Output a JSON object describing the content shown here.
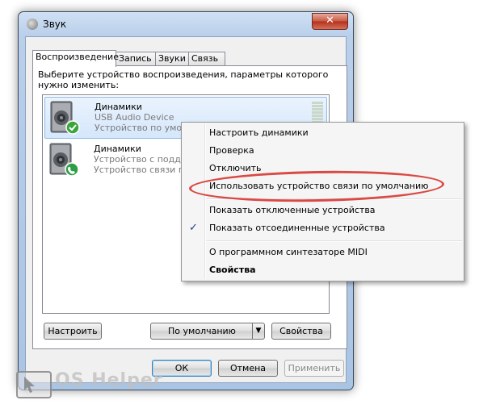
{
  "window": {
    "title": "Звук",
    "close_glyph": "✕"
  },
  "tabs": [
    {
      "label": "Воспроизведение",
      "active": true
    },
    {
      "label": "Запись",
      "active": false
    },
    {
      "label": "Звуки",
      "active": false
    },
    {
      "label": "Связь",
      "active": false
    }
  ],
  "instruction": "Выберите устройство воспроизведения, параметры которого нужно изменить:",
  "devices": [
    {
      "name": "Динамики",
      "line2": "USB Audio Device",
      "line3": "Устройство по умолч",
      "status_icon": "green-check-icon",
      "selected": true
    },
    {
      "name": "Динамики",
      "line2": "Устройство с подде",
      "line3": "Устройство связи по",
      "status_icon": "phone-icon",
      "selected": false
    }
  ],
  "panel_buttons": {
    "configure": "Настроить",
    "default": "По умолчанию",
    "default_arrow": "▼",
    "properties": "Свойства"
  },
  "dialog_buttons": {
    "ok": "ОК",
    "cancel": "Отмена",
    "apply": "Применить"
  },
  "context_menu": {
    "items": [
      "Настроить динамики",
      "Проверка",
      "Отключить",
      "Использовать устройство связи по умолчанию",
      "Показать отключенные устройства",
      "Показать отсоединенные устройства",
      "О программном синтезаторе MIDI",
      "Свойства"
    ],
    "checked_item": "Показать отсоединенные устройства",
    "check_glyph": "✓",
    "highlighted_item": "Использовать устройство связи по умолчанию"
  },
  "watermark": {
    "text": "OS Helper"
  },
  "colors": {
    "highlight": "#d94a45",
    "window_frame": "#aac4e4",
    "check": "#3aa53a"
  }
}
